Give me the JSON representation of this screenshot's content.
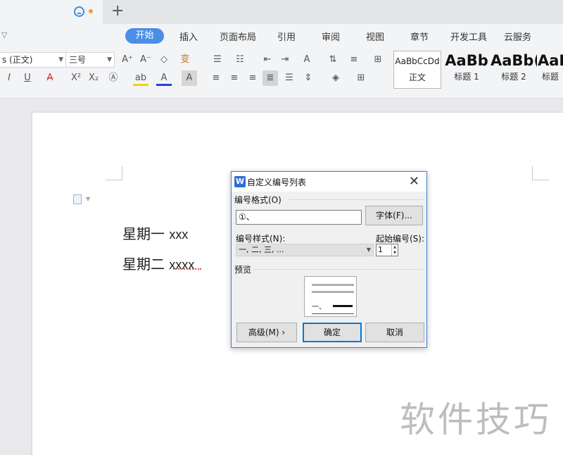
{
  "tabbar": {
    "add_symbol": "+"
  },
  "menu": {
    "caret": "▽",
    "active": "开始",
    "items": [
      "插入",
      "页面布局",
      "引用",
      "审阅",
      "视图",
      "章节",
      "开发工具",
      "云服务"
    ]
  },
  "ribbon": {
    "font_name": "s (正文)",
    "font_size": "三号",
    "styles": {
      "normal_sample": "AaBbCcDd",
      "normal_label": "正文",
      "h1_sample": "AaBb",
      "h1_label": "标题 1",
      "h2_sample": "AaBb(",
      "h2_label": "标题 2",
      "h3_sample": "AaB",
      "h3_label": "标题"
    }
  },
  "document": {
    "line1_cjk": "星期一",
    "line1_latin": "xxx",
    "line2_cjk": "星期二",
    "line2_latin": "xxxx"
  },
  "watermark": "软件技巧",
  "dialog": {
    "app_icon": "W",
    "title": "自定义编号列表",
    "close": "✕",
    "format_label": "编号格式(O)",
    "format_value": "①、",
    "font_button": "字体(F)...",
    "style_label": "编号样式(N):",
    "style_value": "一, 二, 三, ...",
    "start_label": "起始编号(S):",
    "start_value": "1",
    "preview_label": "预览",
    "preview_number": "一、",
    "advanced_button": "高级(M) ›",
    "ok_button": "确定",
    "cancel_button": "取消"
  },
  "colors": {
    "accent": "#4a8ee8",
    "dialog_border": "#3b7fd2",
    "spellcheck": "#e05050"
  }
}
